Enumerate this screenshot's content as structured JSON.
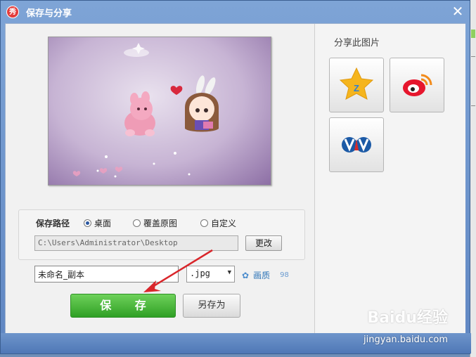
{
  "window": {
    "title": "保存与分享",
    "app_icon_text": "秀",
    "close_symbol": "✕"
  },
  "save_path": {
    "label": "保存路径",
    "options": [
      "桌面",
      "覆盖原图",
      "自定义"
    ],
    "selected_index": 0,
    "path_value": "C:\\Users\\Administrator\\Desktop",
    "change_button": "更改"
  },
  "file": {
    "name_value": "未命名_副本",
    "extension": ".jpg",
    "quality_label": "画质",
    "quality_value": "98"
  },
  "buttons": {
    "save": "保 存",
    "save_as": "另存为"
  },
  "share": {
    "title": "分享此图片",
    "targets": [
      "qzone-icon",
      "weibo-icon",
      "renren-icon"
    ]
  },
  "watermark": {
    "brand": "Baidu经验",
    "url": "jingyan.baidu.com"
  },
  "colors": {
    "save_green": "#3cb530",
    "title_bar": "#6f94c9",
    "annotation_arrow": "#d9262b"
  }
}
